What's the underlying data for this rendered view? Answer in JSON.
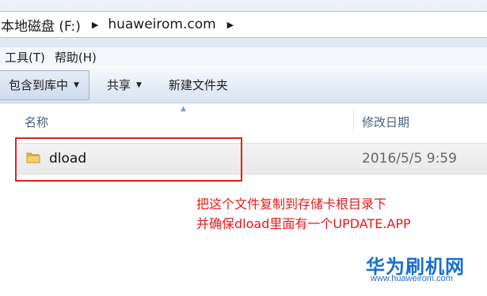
{
  "breadcrumb": {
    "items": [
      "本地磁盘 (F:)",
      "huaweirom.com"
    ]
  },
  "menubar": {
    "items": [
      "工具(T)",
      "帮助(H)"
    ]
  },
  "toolbar": {
    "include_in_library": "包含到库中",
    "share": "共享",
    "new_folder": "新建文件夹"
  },
  "columns": {
    "name": "名称",
    "modified": "修改日期"
  },
  "files": [
    {
      "name": "dload",
      "modified": "2016/5/5 9:59",
      "icon": "folder-icon"
    }
  ],
  "annotation": {
    "line1": "把这个文件复制到存储卡根目录下",
    "line2": "并确保dload里面有一个UPDATE.APP",
    "color": "#e41b1b"
  },
  "watermark": {
    "logo": "华为刷机网",
    "url": "www.huaweirom.com",
    "color": "#1570cf"
  }
}
